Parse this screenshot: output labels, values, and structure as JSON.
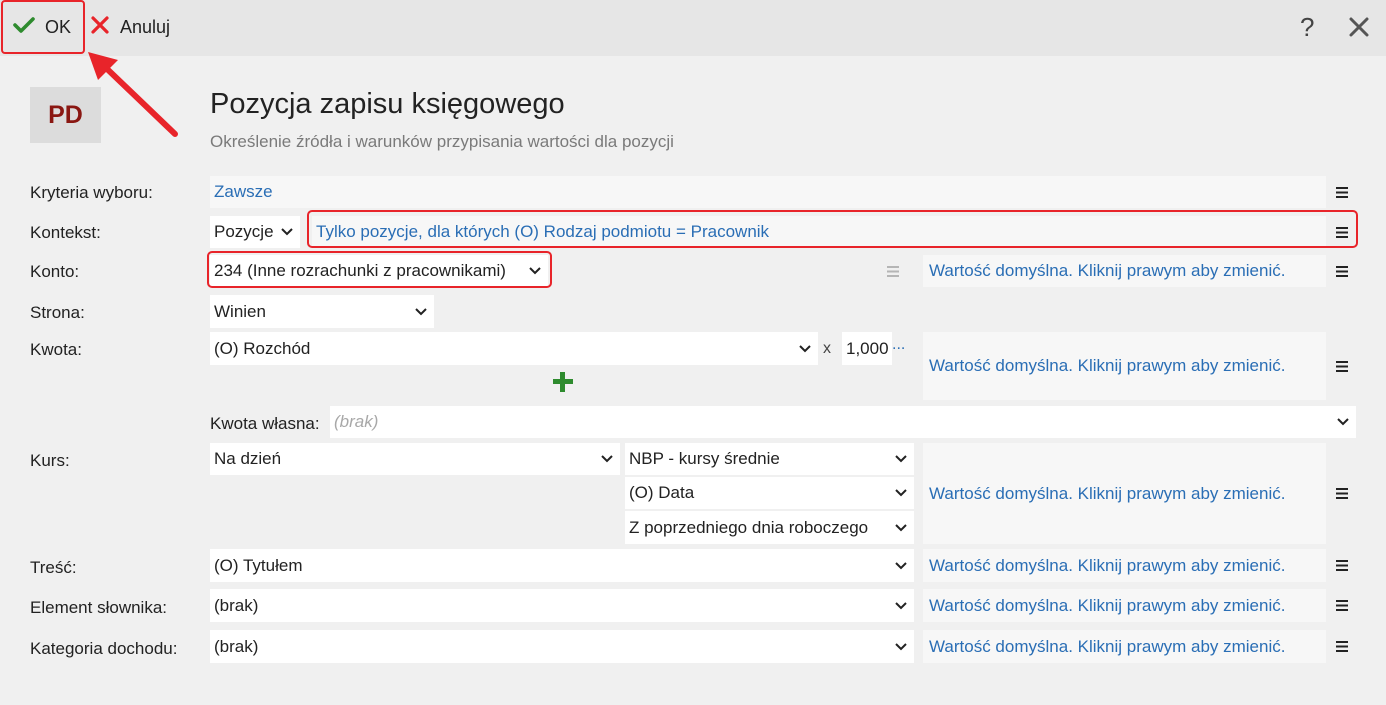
{
  "toolbar": {
    "ok_label": "OK",
    "cancel_label": "Anuluj",
    "help_label": "?",
    "close_label": "✕"
  },
  "header": {
    "logo_text": "PD",
    "title": "Pozycja zapisu księgowego",
    "subtitle": "Określenie źródła i warunków przypisania wartości dla pozycji"
  },
  "form": {
    "kryteria": {
      "label": "Kryteria wyboru:",
      "value": "Zawsze"
    },
    "kontekst": {
      "label": "Kontekst:",
      "select": "Pozycje",
      "condition": "Tylko pozycje, dla których (O) Rodzaj podmiotu = Pracownik"
    },
    "konto": {
      "label": "Konto:",
      "value": "234 (Inne rozrachunki z pracownikami)"
    },
    "strona": {
      "label": "Strona:",
      "value": "Winien"
    },
    "kwota": {
      "label": "Kwota:",
      "value": "(O) Rozchód",
      "multiply": "x",
      "factor": "1,000",
      "factor_more": "..."
    },
    "kwota_wlasna": {
      "label": "Kwota własna:",
      "placeholder": "(brak)"
    },
    "kurs": {
      "label": "Kurs:",
      "mode": "Na dzień",
      "table": "NBP - kursy średnie",
      "date": "(O) Data",
      "rule": "Z poprzedniego dnia roboczego"
    },
    "tresc": {
      "label": "Treść:",
      "value": "(O) Tytułem"
    },
    "element_slownika": {
      "label": "Element słownika:",
      "value": "(brak)"
    },
    "kategoria_dochodu": {
      "label": "Kategoria dochodu:",
      "value": "(brak)"
    }
  },
  "default_value_text": "Wartość domyślna. Kliknij prawym aby zmienić.",
  "colors": {
    "accent_blue": "#2a6eb5",
    "highlight_red": "#e8242a",
    "ok_green": "#2e8b2e",
    "logo_red": "#8a1712"
  }
}
